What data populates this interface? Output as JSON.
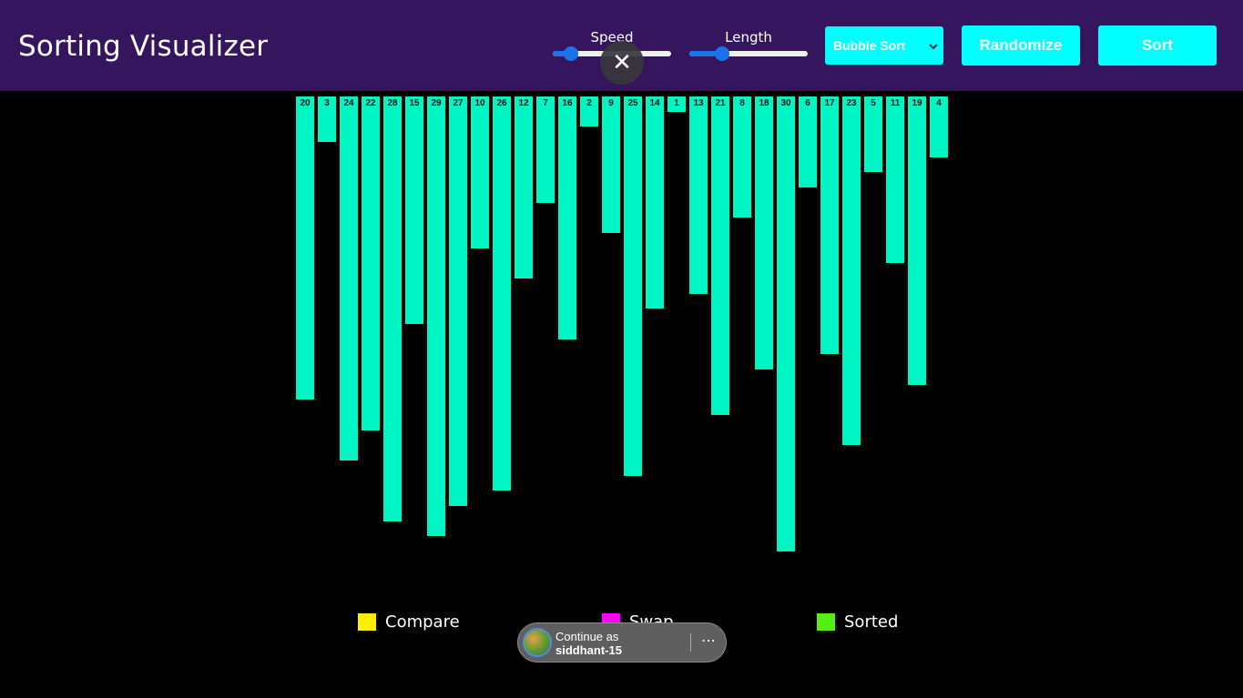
{
  "app": {
    "title": "Sorting Visualizer"
  },
  "controls": {
    "speed": {
      "label": "Speed",
      "value": 0.15
    },
    "length": {
      "label": "Length",
      "value": 0.28
    },
    "algorithm": {
      "selected": "Bubble Sort"
    },
    "randomize_label": "Randomize",
    "sort_label": "Sort",
    "close_glyph": "✕"
  },
  "chart_data": {
    "type": "bar",
    "values": [
      20,
      3,
      24,
      22,
      28,
      15,
      29,
      27,
      10,
      26,
      12,
      7,
      16,
      2,
      9,
      25,
      14,
      1,
      13,
      21,
      8,
      18,
      30,
      6,
      17,
      23,
      5,
      11,
      19,
      4
    ],
    "bar_color": "#00f5c4"
  },
  "legend": [
    {
      "label": "Compare",
      "color": "#ffee00"
    },
    {
      "label": "Swap",
      "color": "#ff00ff"
    },
    {
      "label": "Sorted",
      "color": "#55ee11"
    }
  ],
  "signin_prompt": {
    "line1": "Continue as",
    "username": "siddhant-15",
    "more_glyph": "⋯"
  }
}
